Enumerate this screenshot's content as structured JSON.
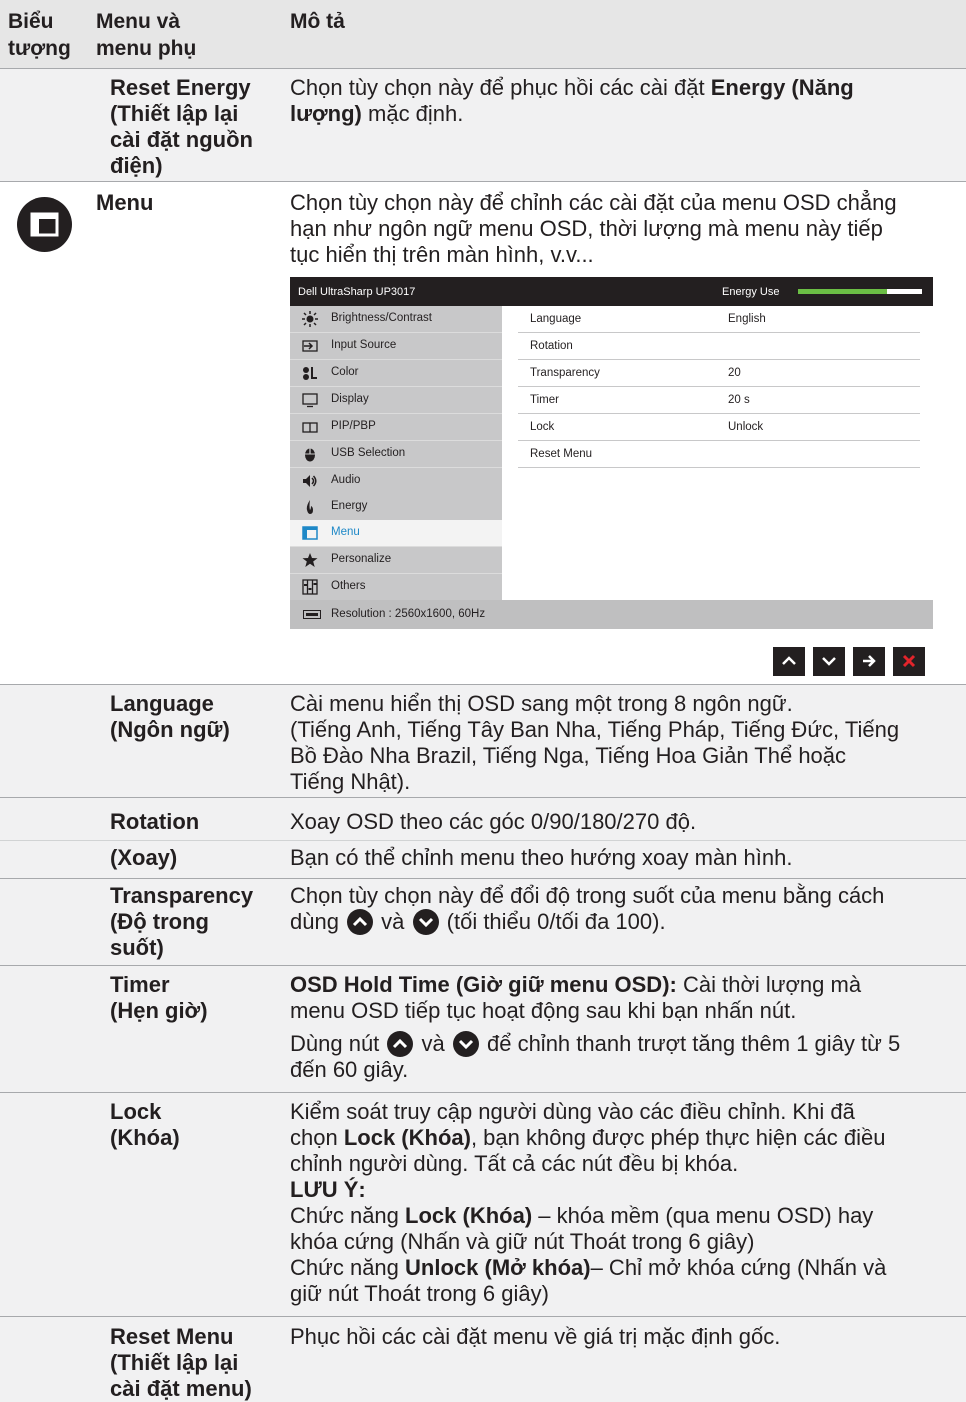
{
  "header": {
    "col1": "Biểu tượng",
    "col1_line1": "Biểu",
    "col1_line2": "tượng",
    "col2_line1": "Menu và",
    "col2_line2": "menu phụ",
    "col3": "Mô tả"
  },
  "reset_energy": {
    "name_lines": [
      "Reset Energy",
      "(Thiết lập lại",
      "cài đặt nguồn",
      "điện)"
    ],
    "desc_pre": "Chọn tùy chọn này để phục hồi các cài đặt ",
    "desc_bold": "Energy (Năng lượng)",
    "desc_bold_l1": "Energy (Năng",
    "desc_bold_l2": "lượng)",
    "desc_post": " mặc định."
  },
  "menu": {
    "icon": "menu-icon",
    "name": "Menu",
    "desc_lines": [
      "Chọn tùy chọn này để chỉnh các cài đặt của menu OSD chẳng",
      "hạn như ngôn ngữ menu OSD, thời lượng mà menu này tiếp",
      "tục hiển thị trên màn hình, v.v..."
    ]
  },
  "osd": {
    "title": "Dell UltraSharp UP3017",
    "energy_label": "Energy Use",
    "energy_level": 0.72,
    "left_items": [
      {
        "label": "Brightness/Contrast",
        "icon": "brightness-icon"
      },
      {
        "label": "Input Source",
        "icon": "input-source-icon"
      },
      {
        "label": "Color",
        "icon": "color-icon"
      },
      {
        "label": "Display",
        "icon": "display-icon"
      },
      {
        "label": "PIP/PBP",
        "icon": "pip-pbp-icon"
      },
      {
        "label": "USB Selection",
        "icon": "usb-icon"
      },
      {
        "label": "Audio",
        "icon": "audio-icon"
      },
      {
        "label": "Energy",
        "icon": "energy-icon"
      },
      {
        "label": "Menu",
        "icon": "menu-icon",
        "selected": true
      },
      {
        "label": "Personalize",
        "icon": "star-icon"
      },
      {
        "label": "Others",
        "icon": "others-icon"
      }
    ],
    "rows": [
      {
        "key": "Language",
        "value": "English"
      },
      {
        "key": "Rotation",
        "value": ""
      },
      {
        "key": "Transparency",
        "value": "20"
      },
      {
        "key": "Timer",
        "value": "20 s"
      },
      {
        "key": "Lock",
        "value": "Unlock"
      },
      {
        "key": "Reset Menu",
        "value": ""
      }
    ],
    "resolution": "Resolution : 2560x1600, 60Hz",
    "nav_buttons": [
      "chevron-up-icon",
      "chevron-down-icon",
      "arrow-right-icon",
      "close-icon"
    ],
    "close_color": "#e3242b"
  },
  "language": {
    "name_lines": [
      "Language",
      "(Ngôn ngữ)"
    ],
    "desc_lines": [
      "Cài menu hiển thị OSD sang một trong 8 ngôn ngữ.",
      "(Tiếng Anh, Tiếng Tây Ban Nha, Tiếng Pháp, Tiếng Đức, Tiếng",
      "Bồ Đào Nha Brazil, Tiếng Nga, Tiếng Hoa Giản Thể hoặc",
      "Tiếng Nhật)."
    ]
  },
  "rotation": {
    "name_lines": [
      "Rotation",
      "(Xoay)"
    ],
    "desc_lines": [
      "Xoay OSD theo các góc 0/90/180/270 độ.",
      "Bạn có thể chỉnh menu theo hướng xoay màn hình."
    ]
  },
  "transparency": {
    "name_lines": [
      "Transparency",
      "(Độ trong",
      "suốt)"
    ],
    "desc_l1": "Chọn tùy chọn này để đổi độ trong suốt của menu bằng cách",
    "desc_l2_pre": "dùng ",
    "desc_l2_mid": " và ",
    "desc_l2_post": " (tối thiểu 0/tối đa 100)."
  },
  "timer": {
    "name_lines": [
      "Timer",
      "(Hẹn giờ)"
    ],
    "bold": "OSD Hold Time (Giờ giữ menu OSD):",
    "l1_post": " Cài thời lượng mà",
    "l2": "menu OSD tiếp tục hoạt động sau khi bạn nhấn nút.",
    "l3_pre": "Dùng nút ",
    "l3_mid": " và ",
    "l3_post": " để chỉnh thanh trượt tăng thêm 1 giây từ 5",
    "l4": "đến 60 giây."
  },
  "lock": {
    "name_lines": [
      "Lock",
      "(Khóa)"
    ],
    "l1": "Kiểm soát truy cập người dùng vào các điều chỉnh. Khi đã",
    "l2_pre": "chọn ",
    "l2_bold": "Lock (Khóa)",
    "l2_post": ", bạn không được phép thực hiện các điều",
    "l3": "chỉnh người dùng. Tất cả các nút đều bị khóa.",
    "note": "LƯU Ý:",
    "l5_pre": "Chức năng ",
    "l5_bold": "Lock (Khóa)",
    "l5_post": " – khóa mềm (qua menu OSD) hay",
    "l6": "khóa cứng (Nhấn và giữ nút Thoát trong 6 giây)",
    "l7_pre": "Chức năng ",
    "l7_bold": "Unlock (Mở khóa)",
    "l7_post": "– Chỉ mở khóa cứng (Nhấn và",
    "l8": "giữ nút Thoát trong 6 giây)"
  },
  "reset_menu": {
    "name_lines": [
      "Reset Menu",
      "(Thiết lập lại",
      "cài đặt menu)"
    ],
    "desc": "Phục hồi các cài đặt menu về giá trị mặc định gốc."
  }
}
